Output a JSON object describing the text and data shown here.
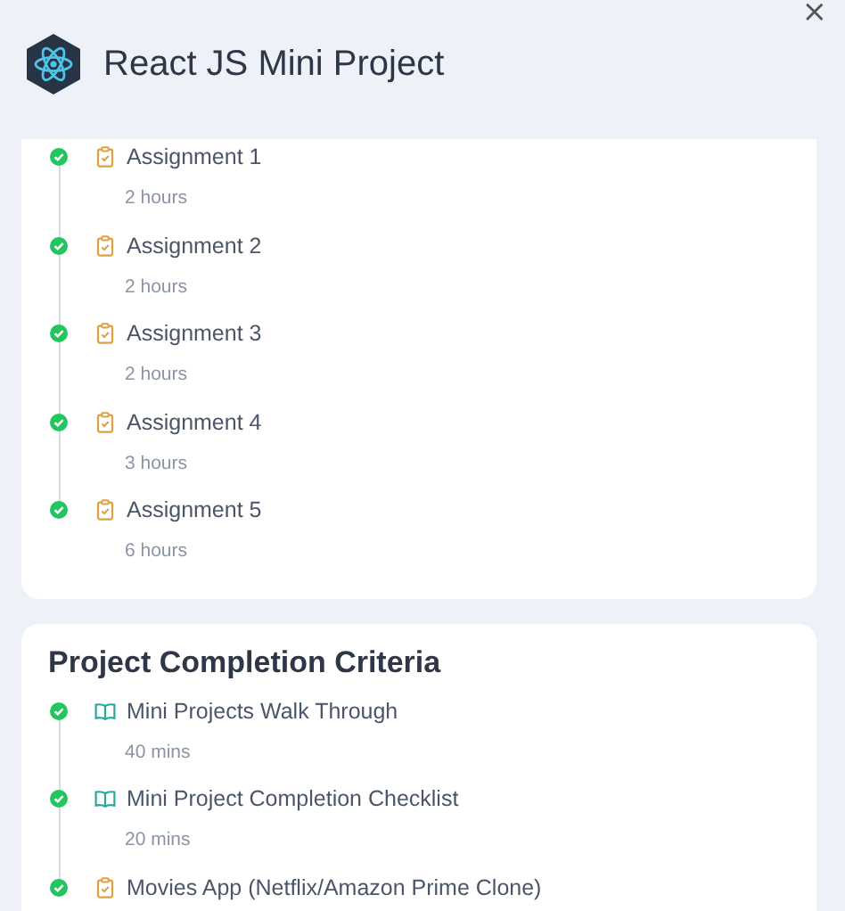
{
  "header": {
    "title": "React JS Mini Project",
    "close": "×"
  },
  "sections": [
    {
      "items": [
        {
          "kind": "assignment",
          "title": "Assignment 1",
          "duration": "2 hours",
          "completed": true
        },
        {
          "kind": "assignment",
          "title": "Assignment 2",
          "duration": "2 hours",
          "completed": true
        },
        {
          "kind": "assignment",
          "title": "Assignment 3",
          "duration": "2 hours",
          "completed": true
        },
        {
          "kind": "assignment",
          "title": "Assignment 4",
          "duration": "3 hours",
          "completed": true
        },
        {
          "kind": "assignment",
          "title": "Assignment 5",
          "duration": "6 hours",
          "completed": true
        }
      ]
    },
    {
      "heading": "Project Completion Criteria",
      "items": [
        {
          "kind": "reading",
          "title": "Mini Projects Walk Through",
          "duration": "40 mins",
          "completed": true
        },
        {
          "kind": "reading",
          "title": "Mini Project Completion Checklist",
          "duration": "20 mins",
          "completed": true
        },
        {
          "kind": "assignment",
          "title": "Movies App (Netflix/Amazon Prime Clone)",
          "completed": true
        }
      ]
    }
  ]
}
